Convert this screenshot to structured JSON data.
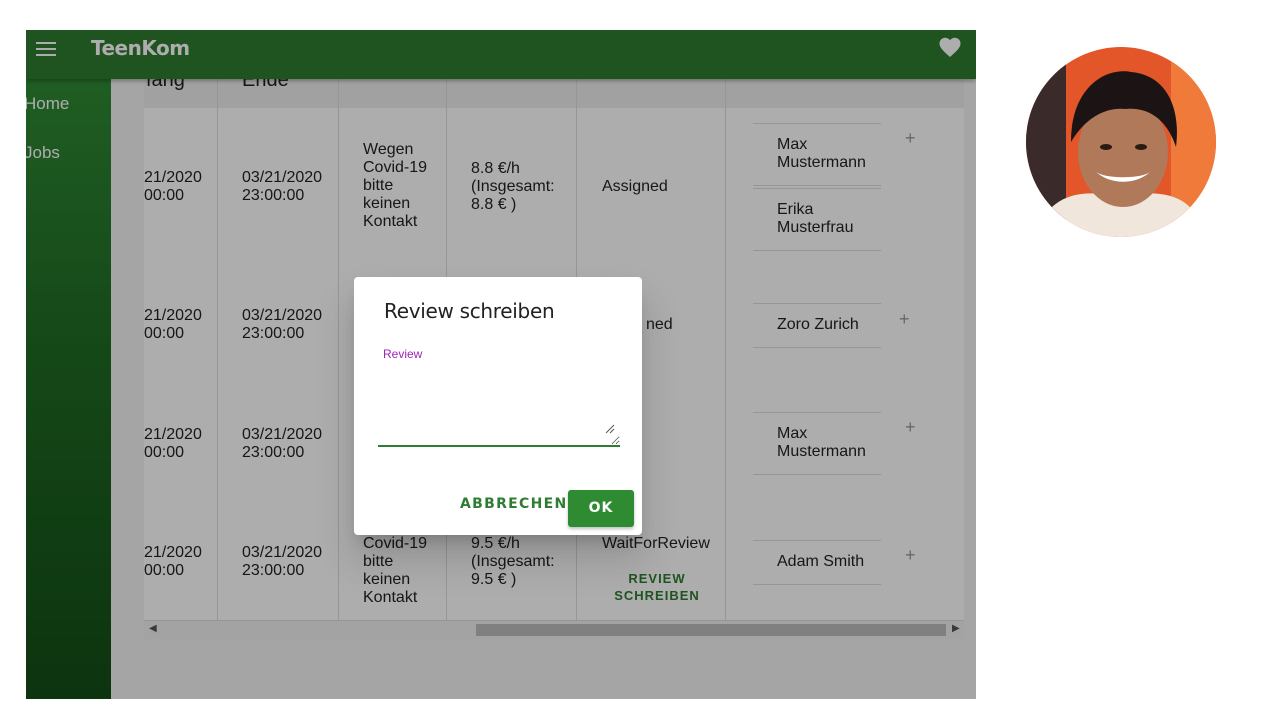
{
  "app": {
    "title": "TeenKom"
  },
  "sidebar": {
    "items": [
      {
        "label": "Home"
      },
      {
        "label": "Jobs"
      }
    ]
  },
  "table": {
    "headers": [
      "fang",
      "Ende"
    ],
    "rows": [
      {
        "start": "21/2020 00:00",
        "end": "03/21/2020 23:00:00",
        "description": [
          "Wegen",
          "Covid-19",
          "bitte",
          "keinen",
          "Kontakt"
        ],
        "pay": [
          "8.8 €/h",
          "(Insgesamt:",
          "8.8 € )"
        ],
        "status": "Assigned",
        "people": [
          "Max Mustermann",
          "Erika Musterfrau"
        ]
      },
      {
        "start": "21/2020 00:00",
        "end": "03/21/2020 23:00:00",
        "status": "ned",
        "people": [
          "Zoro Zurich"
        ]
      },
      {
        "start": "21/2020 00:00",
        "end": "03/21/2020 23:00:00",
        "people": [
          "Max Mustermann"
        ]
      },
      {
        "start": "21/2020 00:00",
        "end": "03/21/2020 23:00:00",
        "description": [
          "Covid-19",
          "bitte",
          "keinen",
          "Kontakt"
        ],
        "pay": [
          "9.5 €/h",
          "(Insgesamt:",
          "9.5 € )"
        ],
        "status": "WaitForReview",
        "action": "REVIEW SCHREIBEN",
        "people": [
          "Adam Smith"
        ]
      }
    ]
  },
  "dialog": {
    "title": "Review schreiben",
    "field_label": "Review",
    "field_value": "",
    "cancel_label": "ABBRECHEN",
    "ok_label": "OK"
  },
  "colors": {
    "primary": "#2e7d32",
    "label_accent": "#9c27b0"
  }
}
